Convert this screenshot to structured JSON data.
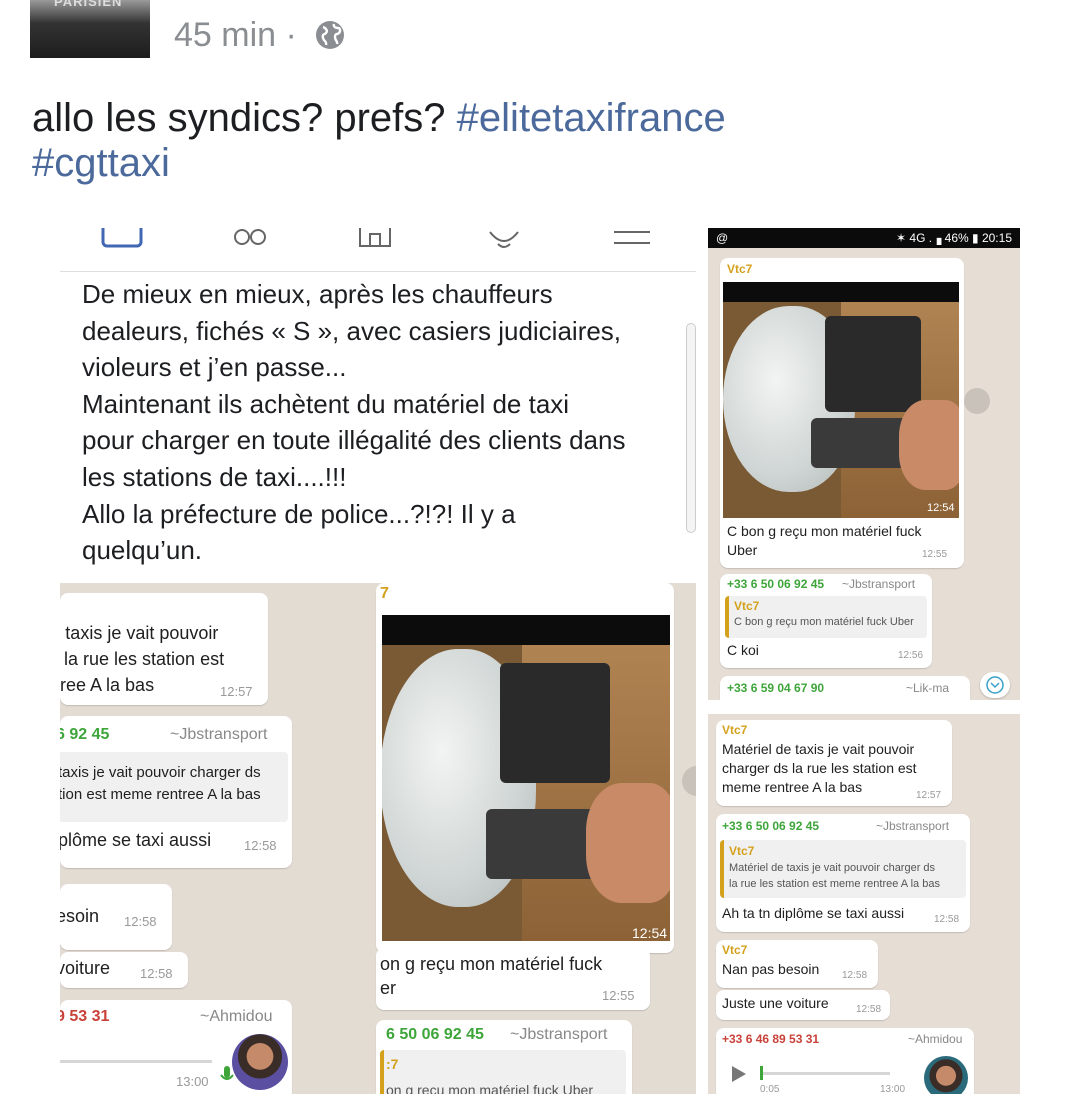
{
  "post": {
    "time": "45 min ·",
    "avatar_text": "PARISIEN",
    "text_main": "allo les syndics? prefs?",
    "hashtag_1": "#elitetaxifrance",
    "hashtag_2": "#cgttaxi"
  },
  "left_screenshot": {
    "fb_post_text": "De mieux en mieux, après les chauffeurs\ndealeurs, fichés « S », avec casiers judiciaires,\nvioleurs et j’en passe...\nMaintenant ils achètent du matériel de taxi\npour charger en toute illégalité des clients dans\nles stations de taxi....!!!\nAllo la préfecture de police...?!?! Il y a\nquelqu’un.",
    "chat_left": {
      "msg1_line1": "• taxis je vait pouvoir",
      "msg1_line2": "la rue les station est",
      "msg1_line3": "ree A la bas",
      "msg1_time": "12:57",
      "sender2_phone": "6 92 45",
      "sender2_name": "~Jbstransport",
      "quote_line1": "taxis je vait pouvoir charger ds",
      "quote_line2": "tion est meme rentree A la bas",
      "msg2_text": "plôme se taxi aussi",
      "msg2_time": "12:58",
      "msg3_text": "esoin",
      "msg3_time": "12:58",
      "msg4_text": "voiture",
      "msg4_time": "12:58",
      "sender5_phone": "9 53 31",
      "sender5_name": "~Ahmidou",
      "voice_time": "13:00"
    },
    "chat_right": {
      "top_label": "7",
      "photo_time": "12:54",
      "caption_line1": "on g reçu mon matériel fuck",
      "caption_line2": "er",
      "caption_time": "12:55",
      "sender_phone": "6 50 06 92 45",
      "sender_name": "~Jbstransport",
      "quote_label": ":7",
      "quote_partial": "on g reçu mon matériel fuck Uber"
    }
  },
  "right_top_screenshot": {
    "status_left": "@",
    "status_right": "✶ 4G .▗ 46% ▮ 20:15",
    "sender1": "Vtc7",
    "photo_time": "12:54",
    "caption_line1": "C bon g reçu mon matériel fuck",
    "caption_line2": "Uber",
    "caption_time": "12:55",
    "reply_phone": "+33 6 50 06 92 45",
    "reply_name": "~Jbstransport",
    "quote_sender": "Vtc7",
    "quote_text": "C bon g reçu mon matériel fuck Uber",
    "reply_text": "C koi",
    "reply_time": "12:56",
    "next_phone": "+33 6 59 04 67 90",
    "next_name": "~Lik-ma"
  },
  "right_bottom_screenshot": {
    "sender1": "Vtc7",
    "msg1_line1": "Matériel de taxis je vait pouvoir",
    "msg1_line2": "charger ds la rue les station est",
    "msg1_line3": "meme rentree A la bas",
    "msg1_time": "12:57",
    "reply_phone": "+33 6 50 06 92 45",
    "reply_name": "~Jbstransport",
    "quote_sender": "Vtc7",
    "quote_line1": "Matériel de taxis je vait pouvoir charger ds",
    "quote_line2": "la rue les station est meme rentree A la bas",
    "reply_text": "Ah ta tn diplôme se taxi aussi",
    "reply_time": "12:58",
    "sender3": "Vtc7",
    "msg3_text": "Nan pas besoin",
    "msg3_time": "12:58",
    "msg4_text": "Juste une voiture",
    "msg4_time": "12:58",
    "voice_phone": "+33 6 46 89 53 31",
    "voice_name": "~Ahmidou",
    "voice_duration": "0:05",
    "voice_time": "13:00"
  },
  "colors": {
    "hashtag": "#4b6a9b",
    "wa_green_sender": "#3ea53a",
    "quote_bar": "#d3a11c",
    "chat_bg": "#e6ded5"
  }
}
